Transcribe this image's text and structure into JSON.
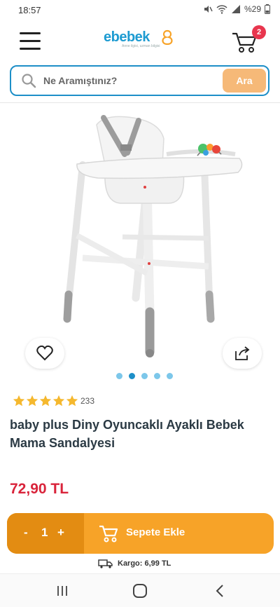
{
  "status_bar": {
    "time": "18:57",
    "battery": "%29"
  },
  "header": {
    "logo_text": "ebebek",
    "logo_tagline": "Anne ilgisi, uzman bilgisi",
    "cart_count": "2"
  },
  "search": {
    "placeholder": "Ne Aramıştınız?",
    "button_label": "Ara"
  },
  "product": {
    "rating_stars": 5,
    "rating_count": "233",
    "title": "baby plus Diny Oyuncaklı Ayaklı Bebek Mama Sandalyesi",
    "price": "72,90 TL",
    "image_count": 5,
    "active_image": 2
  },
  "cart_bar": {
    "minus": "-",
    "quantity": "1",
    "plus": "+",
    "add_label": "Sepete Ekle"
  },
  "shipping": {
    "label": "Kargo: 6,99 TL"
  },
  "colors": {
    "brand_blue": "#1d8fc8",
    "orange": "#f7a328",
    "price_red": "#d9243b",
    "star": "#f5b82e"
  },
  "icons": [
    "hamburger-icon",
    "cart-icon",
    "search-icon",
    "heart-icon",
    "share-icon",
    "star-icon",
    "truck-icon",
    "cart-add-icon"
  ]
}
